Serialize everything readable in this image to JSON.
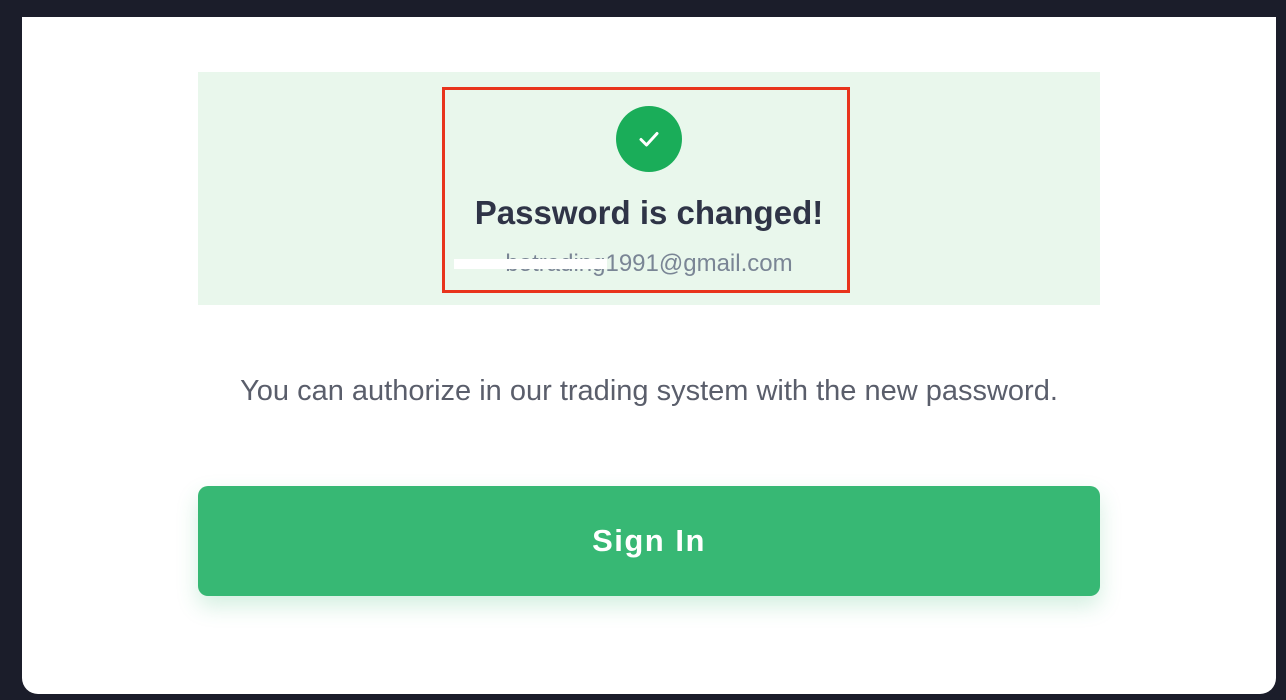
{
  "success": {
    "title": "Password is changed!",
    "email": "botrading1991@gmail.com",
    "icon": "checkmark-icon",
    "colors": {
      "panel_bg": "#e9f7ec",
      "icon_bg": "#1aad59",
      "highlight": "#e8341c"
    }
  },
  "message": "You can authorize in our trading system with the new password.",
  "sign_in": {
    "label": "Sign In",
    "color": "#37b874"
  }
}
